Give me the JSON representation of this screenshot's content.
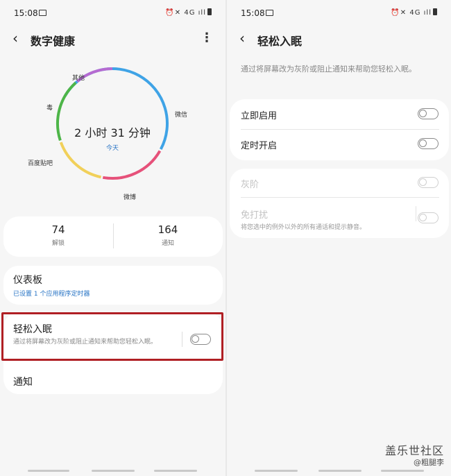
{
  "left": {
    "status": {
      "time": "15:08",
      "right_icons": "⏰✕ 4G ıll"
    },
    "title": "数字健康",
    "ring": {
      "center_time": "2 小时 31 分钟",
      "center_sub": "今天",
      "labels": {
        "other": "其他",
        "du": "毒",
        "wechat": "微信",
        "baidu": "百度贴吧",
        "weibo": "微博"
      },
      "colors": {
        "blue": "#3fa3e6",
        "pink": "#e6517a",
        "yellow": "#f1d05a",
        "green": "#4db548",
        "purple": "#b66bd1"
      }
    },
    "stats": [
      {
        "value": "74",
        "label": "解锁"
      },
      {
        "value": "164",
        "label": "通知"
      }
    ],
    "dashboard": {
      "title": "仪表板",
      "subtitle": "已设置 1 个应用程序定时器"
    },
    "sleep": {
      "title": "轻松入眠",
      "desc": "通过将屏幕改为灰阶或阻止通知来帮助您轻松入眠。",
      "toggle_on": false
    },
    "notify": "通知"
  },
  "right": {
    "status": {
      "time": "15:08",
      "right_icons": "⏰✕ 4G ıll"
    },
    "title": "轻松入眠",
    "desc": "通过将屏幕改为灰阶或阻止通知来帮助您轻松入眠。",
    "rows": [
      {
        "label": "立即启用",
        "toggle_on": false
      },
      {
        "label": "定时开启",
        "toggle_on": false
      }
    ],
    "disabled_rows": [
      {
        "label": "灰阶",
        "toggle_on": false
      },
      {
        "label": "免打扰",
        "sub": "将您选中的例外以外的所有通话和提示静音。",
        "toggle_on": false
      }
    ]
  },
  "watermark": {
    "line1": "盖乐世社区",
    "line2": "@粗腿李"
  }
}
